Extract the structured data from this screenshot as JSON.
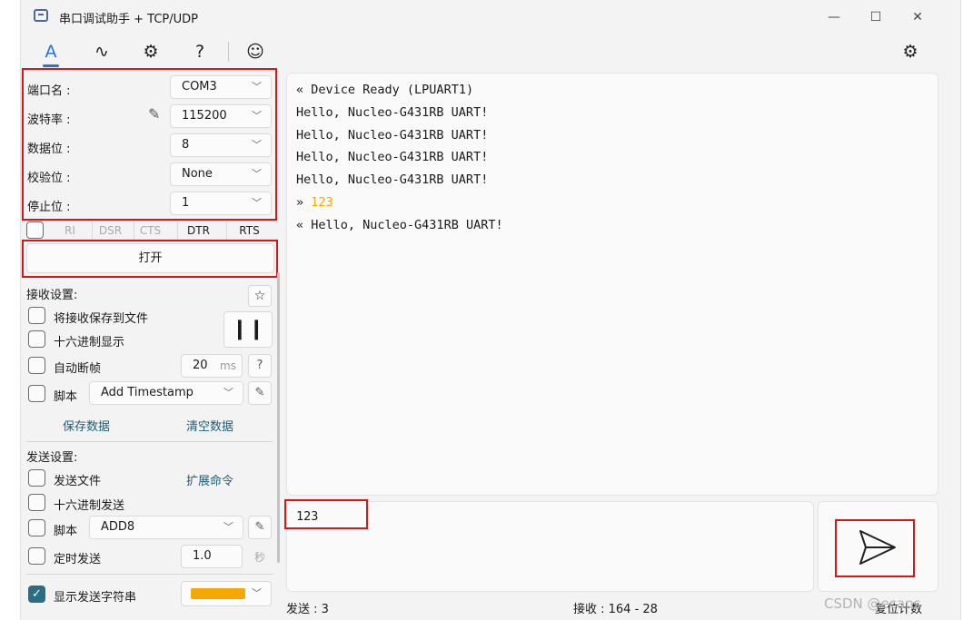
{
  "window": {
    "title": "串口调试助手 + TCP/UDP",
    "min": "—",
    "max": "☐",
    "close": "✕"
  },
  "toolbar": {
    "serial": "A",
    "wave": "∿",
    "plugin": "⚙",
    "help": "?",
    "emoji": "☺",
    "settings": "⚙"
  },
  "serial": {
    "port_label": "端口名 :",
    "port_value": "COM3",
    "baud_label": "波特率 :",
    "baud_value": "115200",
    "data_label": "数据位 :",
    "data_value": "8",
    "parity_label": "校验位 :",
    "parity_value": "None",
    "stop_label": "停止位 :",
    "stop_value": "1",
    "pins": [
      "RI",
      "DSR",
      "CTS",
      "DTR",
      "RTS"
    ],
    "open_button": "打开"
  },
  "receive": {
    "header": "接收设置:",
    "save_to_file": "将接收保存到文件",
    "hex_display": "十六进制显示",
    "auto_frame": "自动断帧",
    "frame_ms": "20",
    "frame_unit": "ms",
    "help": "?",
    "script_label": "脚本",
    "script_value": "Add Timestamp",
    "save_data": "保存数据",
    "clear_data": "清空数据"
  },
  "send": {
    "header": "发送设置:",
    "send_file": "发送文件",
    "ext_cmd": "扩展命令",
    "hex_send": "十六进制发送",
    "script_label": "脚本",
    "script_value": "ADD8",
    "timed_send": "定时发送",
    "interval": "1.0",
    "interval_unit": "秒",
    "show_send": "显示发送字符串",
    "color": "#f5a800"
  },
  "terminal": {
    "lines": [
      {
        "prefix": "« ",
        "text": "Device Ready (LPUART1)"
      },
      {
        "prefix": "",
        "text": "Hello, Nucleo-G431RB UART!"
      },
      {
        "prefix": "",
        "text": "Hello, Nucleo-G431RB UART!"
      },
      {
        "prefix": "",
        "text": "Hello, Nucleo-G431RB UART!"
      },
      {
        "prefix": "",
        "text": "Hello, Nucleo-G431RB UART!"
      },
      {
        "prefix": "» ",
        "text": "123"
      },
      {
        "prefix": "« ",
        "text": "Hello, Nucleo-G431RB UART!"
      }
    ],
    "sent_color": "#f5a800"
  },
  "input": {
    "value": "123"
  },
  "status": {
    "sent": "发送 : 3",
    "received": "接收 : 164  -  28",
    "reset": "复位计数"
  },
  "watermark": "CSDN @ecans"
}
